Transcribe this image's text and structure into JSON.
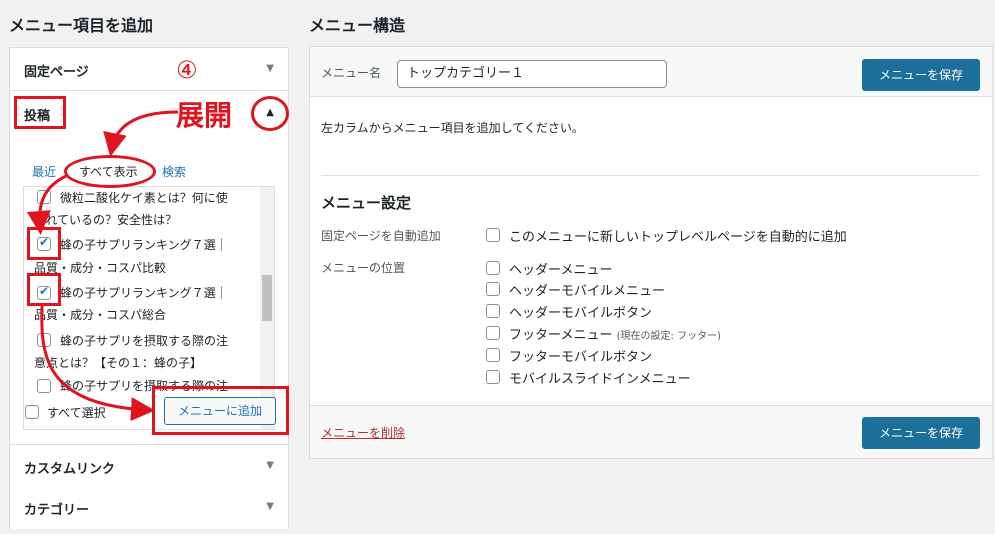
{
  "left": {
    "title": "メニュー項目を追加",
    "accordions": {
      "pages": "固定ページ",
      "posts": "投稿",
      "custom_links": "カスタムリンク",
      "categories": "カテゴリー"
    },
    "tabs": {
      "recent": "最近",
      "all": "すべて表示",
      "search": "検索"
    },
    "posts_list": [
      {
        "line1": "微粒二酸化ケイ素とは？何に使",
        "line2": "われているの？安全性は？",
        "checked": false
      },
      {
        "line1": "蜂の子サプリランキング７選｜",
        "line2": "品質・成分・コスパ比較",
        "checked": true
      },
      {
        "line1": "蜂の子サプリランキング７選｜",
        "line2": "品質・成分・コスパ総合",
        "checked": true
      },
      {
        "line1": "蜂の子サプリを摂取する際の注",
        "line2": "意点とは？【その１：蜂の子】",
        "checked": false
      },
      {
        "line1": "蜂の子サプリを摂取する際の注",
        "checked": false
      }
    ],
    "select_all": "すべて選択",
    "add_button": "メニューに追加"
  },
  "right": {
    "title": "メニュー構造",
    "menu_name_label": "メニュー名",
    "menu_name_value": "トップカテゴリー１",
    "save_button": "メニューを保存",
    "instructions": "左カラムからメニュー項目を追加してください。",
    "settings": {
      "title": "メニュー設定",
      "auto_add_label": "固定ページを自動追加",
      "auto_add_option": "このメニューに新しいトップレベルページを自動的に追加",
      "location_label": "メニューの位置",
      "locations": [
        {
          "label": "ヘッダーメニュー",
          "note": ""
        },
        {
          "label": "ヘッダーモバイルメニュー",
          "note": ""
        },
        {
          "label": "ヘッダーモバイルボタン",
          "note": ""
        },
        {
          "label": "フッターメニュー",
          "note": "(現在の設定: フッター)"
        },
        {
          "label": "フッターモバイルボタン",
          "note": ""
        },
        {
          "label": "モバイルスライドインメニュー",
          "note": ""
        }
      ]
    },
    "delete_link": "メニューを削除"
  },
  "annotations": {
    "step_number": "④",
    "expand_label": "展開",
    "color": "#e0141e"
  }
}
